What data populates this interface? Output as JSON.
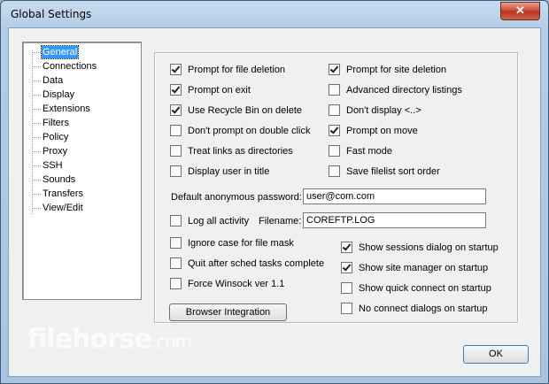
{
  "window": {
    "title": "Global Settings",
    "close_glyph": "✕"
  },
  "tree": {
    "items": [
      "General",
      "Connections",
      "Data",
      "Display",
      "Extensions",
      "Filters",
      "Policy",
      "Proxy",
      "SSH",
      "Sounds",
      "Transfers",
      "View/Edit"
    ],
    "selected": "General"
  },
  "options_left": [
    {
      "label": "Prompt for file deletion",
      "checked": true
    },
    {
      "label": "Prompt on exit",
      "checked": true
    },
    {
      "label": "Use Recycle Bin on delete",
      "checked": true
    },
    {
      "label": "Don't prompt on double click",
      "checked": false
    },
    {
      "label": "Treat links as directories",
      "checked": false
    },
    {
      "label": "Display user in title",
      "checked": false
    }
  ],
  "options_right": [
    {
      "label": "Prompt for site deletion",
      "checked": true
    },
    {
      "label": "Advanced directory listings",
      "checked": false
    },
    {
      "label": "Don't display <..>",
      "checked": false
    },
    {
      "label": "Prompt on move",
      "checked": true
    },
    {
      "label": "Fast mode",
      "checked": false
    },
    {
      "label": "Save filelist sort order",
      "checked": false
    }
  ],
  "anon_password": {
    "label": "Default anonymous password:",
    "value": "user@com.com"
  },
  "log_all_activity": {
    "label": "Log all activity",
    "checked": false
  },
  "filename": {
    "label": "Filename:",
    "value": "COREFTP.LOG"
  },
  "options_bottom_left": [
    {
      "label": "Ignore case for file mask",
      "checked": false
    },
    {
      "label": "Quit after sched tasks complete",
      "checked": false
    },
    {
      "label": "Force Winsock ver 1.1",
      "checked": false
    }
  ],
  "options_bottom_right": [
    {
      "label": "Show sessions dialog on startup",
      "checked": true
    },
    {
      "label": "Show site manager on startup",
      "checked": true
    },
    {
      "label": "Show quick connect on startup",
      "checked": false
    },
    {
      "label": "No connect dialogs on startup",
      "checked": false
    }
  ],
  "buttons": {
    "browser_integration": "Browser Integration",
    "ok": "OK"
  },
  "watermark": {
    "name": "filehorse",
    "suffix": ".com"
  }
}
